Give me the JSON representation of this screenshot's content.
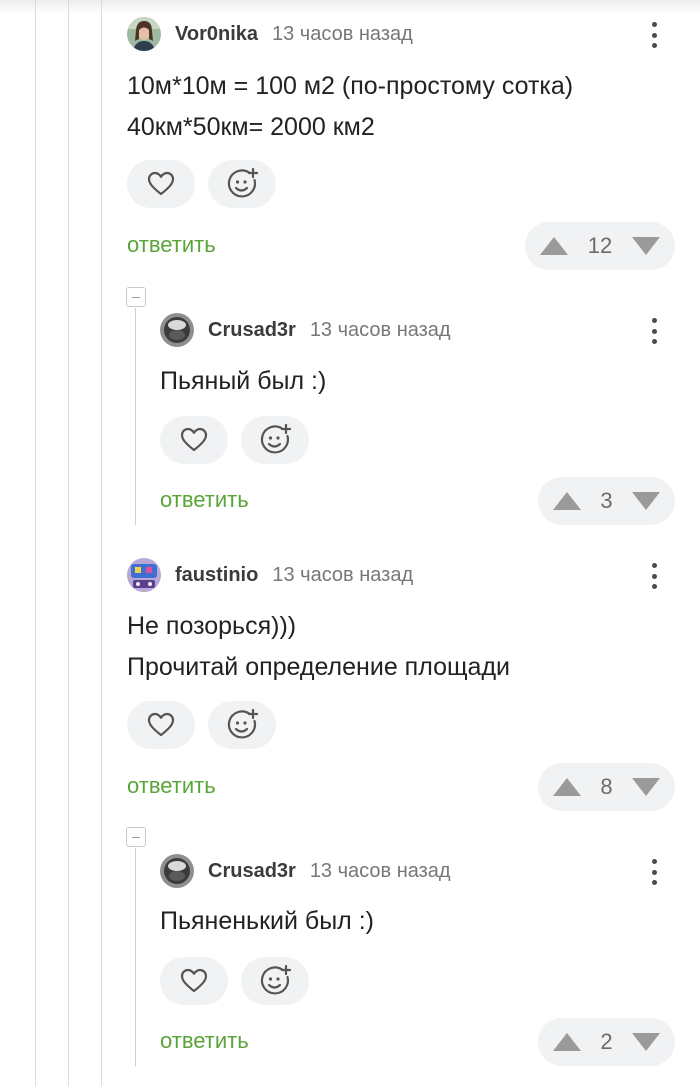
{
  "comments": [
    {
      "author": "Vor0nika",
      "time": "13 часов назад",
      "lines": [
        "10м*10м = 100 м2 (по-простому сотка)",
        "40км*50км= 2000 км2"
      ],
      "reply_label": "ответить",
      "rating": "12"
    },
    {
      "author": "Crusad3r",
      "time": "13 часов назад",
      "lines": [
        "Пьяный был :)"
      ],
      "reply_label": "ответить",
      "rating": "3"
    },
    {
      "author": "faustinio",
      "time": "13 часов назад",
      "lines": [
        "Не позорься)))",
        "Прочитай определение площади"
      ],
      "reply_label": "ответить",
      "rating": "8"
    },
    {
      "author": "Crusad3r",
      "time": "13 часов назад",
      "lines": [
        "Пьяненький был :)"
      ],
      "reply_label": "ответить",
      "rating": "2"
    }
  ],
  "icons": {
    "like": "heart-icon",
    "reaction": "add-emoji-icon",
    "more": "more-vertical-icon",
    "upvote": "triangle-up-icon",
    "downvote": "triangle-down-icon",
    "collapse": "collapse-thread-icon"
  },
  "colors": {
    "reply_link": "#5aa43a",
    "button_bg": "#f0f2f4",
    "arrow": "#9a9a9a"
  }
}
